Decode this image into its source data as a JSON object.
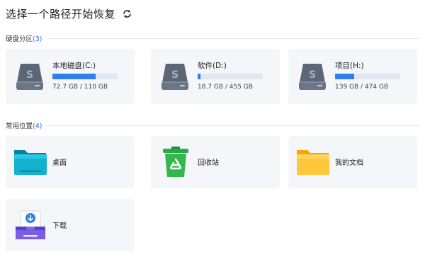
{
  "header": {
    "title": "选择一个路径开始恢复",
    "refresh_icon": "refresh-icon"
  },
  "disks_section": {
    "label": "硬盘分区",
    "count": "(3)"
  },
  "disks": [
    {
      "name": "本地磁盘(C:)",
      "size": "72.7 GB / 110 GB",
      "used_fraction": 0.66,
      "icon": "hard-drive-icon"
    },
    {
      "name": "软件(D:)",
      "size": "18.7 GB / 455 GB",
      "used_fraction": 0.04,
      "icon": "hard-drive-icon"
    },
    {
      "name": "项目(H:)",
      "size": "139 GB / 474 GB",
      "used_fraction": 0.29,
      "icon": "hard-drive-icon"
    }
  ],
  "locations_section": {
    "label": "常用位置",
    "count": "(4)"
  },
  "locations": [
    {
      "label": "桌面",
      "icon": "desktop-folder-icon"
    },
    {
      "label": "回收站",
      "icon": "recycle-bin-icon"
    },
    {
      "label": "我的文档",
      "icon": "documents-folder-icon"
    },
    {
      "label": "下载",
      "icon": "downloads-icon"
    }
  ],
  "colors": {
    "accent": "#2f80ed",
    "bar_track": "#e1e6ef",
    "card_bg": "#f5f6f9",
    "count": "#2f6fe4"
  }
}
